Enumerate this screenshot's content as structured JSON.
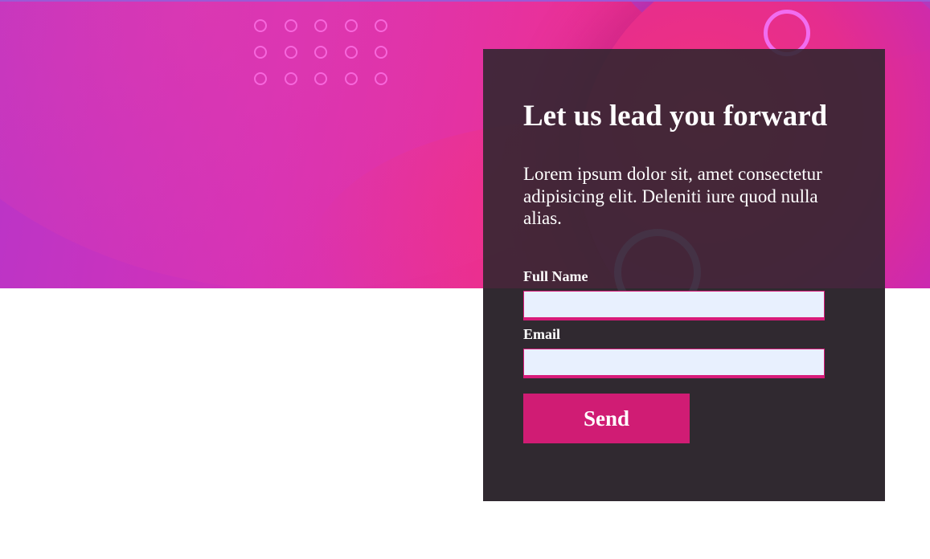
{
  "hero": {
    "colors": {
      "gradient_start": "#b935c8",
      "gradient_mid": "#e82e98",
      "gradient_end": "#d63aa8",
      "dot_outline": "#ff78eb",
      "ring_accent": "#f16df0"
    }
  },
  "card": {
    "heading": "Let us lead you forward",
    "description": "Lorem ipsum dolor sit, amet consectetur adipisicing elit. Deleniti iure quod nulla alias.",
    "background_color": "#434343",
    "form": {
      "full_name_label": "Full Name",
      "full_name_value": "",
      "full_name_placeholder": "",
      "email_label": "Email",
      "email_value": "",
      "email_placeholder": "",
      "send_label": "Send",
      "accent_color": "#d01c74",
      "input_background": "#e8f0fe"
    }
  }
}
